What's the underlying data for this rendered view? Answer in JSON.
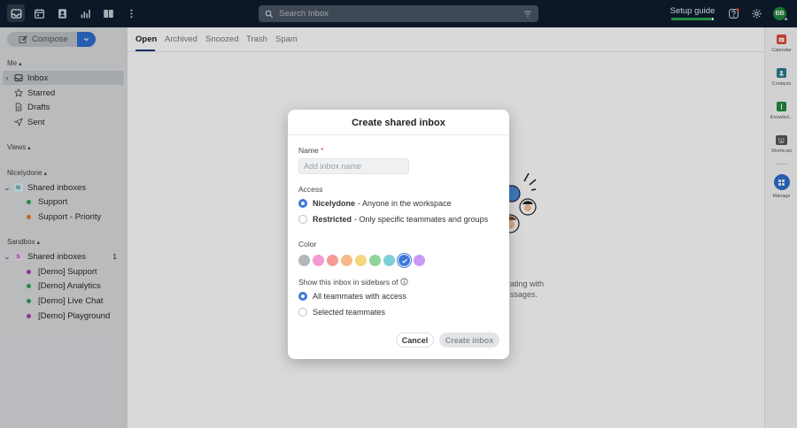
{
  "topbar": {
    "icons": [
      "inbox-icon",
      "calendar-icon",
      "contacts-icon",
      "analytics-icon",
      "knowledge-base-icon",
      "more-vertical-icon"
    ],
    "search_placeholder": "Search Inbox",
    "setup_guide_label": "Setup guide",
    "setup_progress": 0.95,
    "avatar_initials": "BB"
  },
  "sidebar": {
    "compose_label": "Compose",
    "me_header": "Me",
    "me_items": [
      {
        "label": "Inbox",
        "icon": "inbox-icon",
        "selected": true
      },
      {
        "label": "Starred",
        "icon": "star-icon"
      },
      {
        "label": "Drafts",
        "icon": "draft-icon"
      },
      {
        "label": "Sent",
        "icon": "send-icon"
      }
    ],
    "views_header": "Views",
    "workspaces": [
      {
        "header": "Nicelydone",
        "badge": "N",
        "badge_color": "#d8eef0",
        "group_label": "Shared inboxes",
        "count": "",
        "inboxes": [
          {
            "label": "Support",
            "color": "#2e9e5b"
          },
          {
            "label": "Support - Priority",
            "color": "#e07b2f"
          }
        ]
      },
      {
        "header": "Sandbox",
        "badge": "S",
        "badge_color": "#f2d7ea",
        "group_label": "Shared inboxes",
        "count": "1",
        "inboxes": [
          {
            "label": "[Demo] Support",
            "color": "#b03ab0"
          },
          {
            "label": "[Demo] Analytics",
            "color": "#2e9e5b"
          },
          {
            "label": "[Demo] Live Chat",
            "color": "#2e9e5b"
          },
          {
            "label": "[Demo] Playground",
            "color": "#b03ab0"
          }
        ]
      }
    ]
  },
  "main": {
    "tabs": [
      "Open",
      "Archived",
      "Snoozed",
      "Trash",
      "Spam"
    ],
    "active_tab": "Open",
    "empty_title_fragment": "es",
    "empty_text_line1_fragment": "orating with",
    "empty_text_line2_fragment": "ssages."
  },
  "rail": {
    "items": [
      {
        "label": "Calendar",
        "icon": "calendar-icon",
        "color": "#e0493b"
      },
      {
        "label": "Contacts",
        "icon": "contacts-icon",
        "color": "#2a7f8f"
      },
      {
        "label": "Knowled...",
        "icon": "knowledge-base-icon",
        "color": "#1f8b3e"
      },
      {
        "label": "Shortcuts",
        "icon": "keyboard-icon",
        "color": "#555"
      },
      {
        "label": "Manage",
        "icon": "grid-icon",
        "color": "#2f6fcf"
      }
    ]
  },
  "modal": {
    "title": "Create shared inbox",
    "name_label": "Name",
    "name_required_mark": "*",
    "name_placeholder": "Add inbox name",
    "name_value": "",
    "access_label": "Access",
    "access_options": [
      {
        "bold": "Nicelydone",
        "text": "- Anyone in the workspace",
        "checked": true
      },
      {
        "bold": "Restricted",
        "text": "- Only specific teammates and groups",
        "checked": false
      }
    ],
    "color_label": "Color",
    "colors": [
      "#b3b6ba",
      "#f29ad1",
      "#f79a9a",
      "#f7b989",
      "#f3d67e",
      "#8fd69a",
      "#7fd0d6",
      "#3b78d8",
      "#c99bf2"
    ],
    "selected_color_index": 7,
    "sidebar_label": "Show this inbox in sidebars of",
    "sidebar_options": [
      {
        "text": "All teammates with access",
        "checked": true
      },
      {
        "text": "Selected teammates",
        "checked": false
      }
    ],
    "cancel_label": "Cancel",
    "create_label": "Create inbox"
  }
}
